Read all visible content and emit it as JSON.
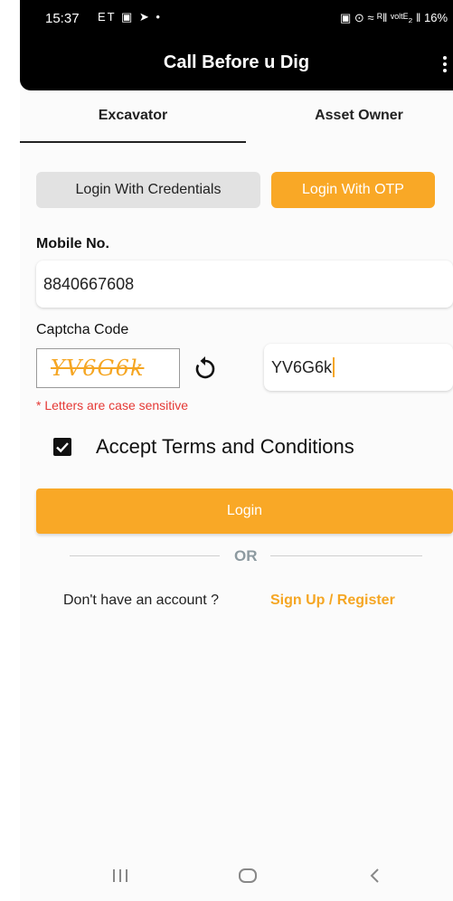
{
  "status_bar": {
    "time": "15:37",
    "left_icons": "ET ▣ ➤ •",
    "right_text": "▣ ⊙ ≈ ᴿ‖ ᵛᵒˡᵗᴱ₂ ‖ 16%"
  },
  "app_bar": {
    "title": "Call Before u Dig",
    "menu_icon": "more-vert-icon"
  },
  "tabs": [
    {
      "label": "Excavator",
      "selected": true
    },
    {
      "label": "Asset Owner",
      "selected": false
    }
  ],
  "login_modes": {
    "credentials_label": "Login With Credentials",
    "otp_label": "Login With OTP",
    "active": "otp"
  },
  "mobile": {
    "label": "Mobile No.",
    "value": "8840667608"
  },
  "captcha": {
    "label": "Captcha Code",
    "code": "YV6G6k",
    "refresh_icon": "refresh-icon",
    "input_value": "YV6G6k",
    "hint": "* Letters are case sensitive"
  },
  "terms": {
    "label": "Accept Terms and Conditions",
    "checked": true
  },
  "login_button": "Login",
  "divider_text": "OR",
  "signup": {
    "question": "Don't have an account ?",
    "link": "Sign Up / Register"
  },
  "nav_bar": {
    "recent_icon": "recent-apps-icon",
    "home_icon": "home-icon",
    "back_icon": "back-icon"
  },
  "colors": {
    "accent": "#f9a826",
    "app_bar": "#000000",
    "error": "#e53935"
  }
}
